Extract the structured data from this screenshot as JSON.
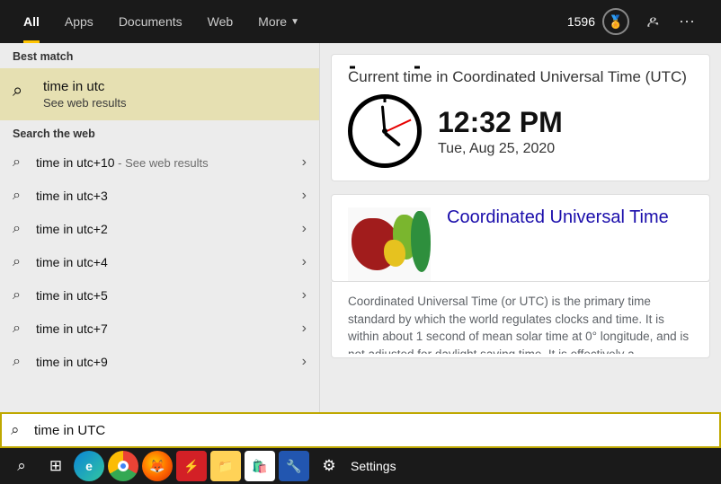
{
  "tabs": [
    "All",
    "Apps",
    "Documents",
    "Web",
    "More"
  ],
  "points": "1596",
  "left": {
    "best_label": "Best match",
    "bestmatch": {
      "title": "time in utc",
      "subtitle": "See web results"
    },
    "web_label": "Search the web",
    "items": [
      {
        "text": "time in utc+10",
        "annot": " - See web results"
      },
      {
        "text": "time in utc+3",
        "annot": ""
      },
      {
        "text": "time in utc+2",
        "annot": ""
      },
      {
        "text": "time in utc+4",
        "annot": ""
      },
      {
        "text": "time in utc+5",
        "annot": ""
      },
      {
        "text": "time in utc+7",
        "annot": ""
      },
      {
        "text": "time in utc+9",
        "annot": ""
      }
    ]
  },
  "right": {
    "card1_title": "Current time in Coordinated Universal Time (UTC)",
    "time": "12:32 PM",
    "date": "Tue, Aug 25, 2020",
    "card2_title": "Coordinated Universal Time",
    "desc": "Coordinated Universal Time (or UTC) is the primary time standard by which the world regulates clocks and time. It is within about 1 second of mean solar time at 0° longitude, and is not adjusted for daylight saving time. It is effectively a"
  },
  "search": {
    "value": "time in UTC"
  },
  "taskbar": {
    "settings": "Settings"
  }
}
